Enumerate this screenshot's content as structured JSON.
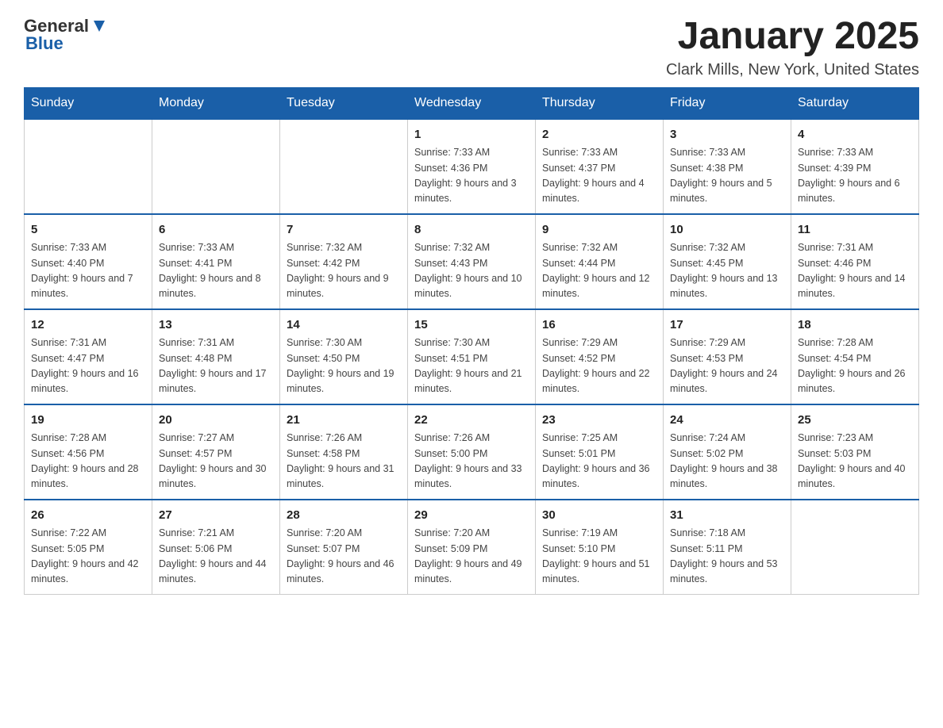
{
  "logo": {
    "general": "General",
    "blue": "Blue"
  },
  "title": "January 2025",
  "subtitle": "Clark Mills, New York, United States",
  "days_of_week": [
    "Sunday",
    "Monday",
    "Tuesday",
    "Wednesday",
    "Thursday",
    "Friday",
    "Saturday"
  ],
  "weeks": [
    [
      {
        "day": "",
        "info": ""
      },
      {
        "day": "",
        "info": ""
      },
      {
        "day": "",
        "info": ""
      },
      {
        "day": "1",
        "info": "Sunrise: 7:33 AM\nSunset: 4:36 PM\nDaylight: 9 hours and 3 minutes."
      },
      {
        "day": "2",
        "info": "Sunrise: 7:33 AM\nSunset: 4:37 PM\nDaylight: 9 hours and 4 minutes."
      },
      {
        "day": "3",
        "info": "Sunrise: 7:33 AM\nSunset: 4:38 PM\nDaylight: 9 hours and 5 minutes."
      },
      {
        "day": "4",
        "info": "Sunrise: 7:33 AM\nSunset: 4:39 PM\nDaylight: 9 hours and 6 minutes."
      }
    ],
    [
      {
        "day": "5",
        "info": "Sunrise: 7:33 AM\nSunset: 4:40 PM\nDaylight: 9 hours and 7 minutes."
      },
      {
        "day": "6",
        "info": "Sunrise: 7:33 AM\nSunset: 4:41 PM\nDaylight: 9 hours and 8 minutes."
      },
      {
        "day": "7",
        "info": "Sunrise: 7:32 AM\nSunset: 4:42 PM\nDaylight: 9 hours and 9 minutes."
      },
      {
        "day": "8",
        "info": "Sunrise: 7:32 AM\nSunset: 4:43 PM\nDaylight: 9 hours and 10 minutes."
      },
      {
        "day": "9",
        "info": "Sunrise: 7:32 AM\nSunset: 4:44 PM\nDaylight: 9 hours and 12 minutes."
      },
      {
        "day": "10",
        "info": "Sunrise: 7:32 AM\nSunset: 4:45 PM\nDaylight: 9 hours and 13 minutes."
      },
      {
        "day": "11",
        "info": "Sunrise: 7:31 AM\nSunset: 4:46 PM\nDaylight: 9 hours and 14 minutes."
      }
    ],
    [
      {
        "day": "12",
        "info": "Sunrise: 7:31 AM\nSunset: 4:47 PM\nDaylight: 9 hours and 16 minutes."
      },
      {
        "day": "13",
        "info": "Sunrise: 7:31 AM\nSunset: 4:48 PM\nDaylight: 9 hours and 17 minutes."
      },
      {
        "day": "14",
        "info": "Sunrise: 7:30 AM\nSunset: 4:50 PM\nDaylight: 9 hours and 19 minutes."
      },
      {
        "day": "15",
        "info": "Sunrise: 7:30 AM\nSunset: 4:51 PM\nDaylight: 9 hours and 21 minutes."
      },
      {
        "day": "16",
        "info": "Sunrise: 7:29 AM\nSunset: 4:52 PM\nDaylight: 9 hours and 22 minutes."
      },
      {
        "day": "17",
        "info": "Sunrise: 7:29 AM\nSunset: 4:53 PM\nDaylight: 9 hours and 24 minutes."
      },
      {
        "day": "18",
        "info": "Sunrise: 7:28 AM\nSunset: 4:54 PM\nDaylight: 9 hours and 26 minutes."
      }
    ],
    [
      {
        "day": "19",
        "info": "Sunrise: 7:28 AM\nSunset: 4:56 PM\nDaylight: 9 hours and 28 minutes."
      },
      {
        "day": "20",
        "info": "Sunrise: 7:27 AM\nSunset: 4:57 PM\nDaylight: 9 hours and 30 minutes."
      },
      {
        "day": "21",
        "info": "Sunrise: 7:26 AM\nSunset: 4:58 PM\nDaylight: 9 hours and 31 minutes."
      },
      {
        "day": "22",
        "info": "Sunrise: 7:26 AM\nSunset: 5:00 PM\nDaylight: 9 hours and 33 minutes."
      },
      {
        "day": "23",
        "info": "Sunrise: 7:25 AM\nSunset: 5:01 PM\nDaylight: 9 hours and 36 minutes."
      },
      {
        "day": "24",
        "info": "Sunrise: 7:24 AM\nSunset: 5:02 PM\nDaylight: 9 hours and 38 minutes."
      },
      {
        "day": "25",
        "info": "Sunrise: 7:23 AM\nSunset: 5:03 PM\nDaylight: 9 hours and 40 minutes."
      }
    ],
    [
      {
        "day": "26",
        "info": "Sunrise: 7:22 AM\nSunset: 5:05 PM\nDaylight: 9 hours and 42 minutes."
      },
      {
        "day": "27",
        "info": "Sunrise: 7:21 AM\nSunset: 5:06 PM\nDaylight: 9 hours and 44 minutes."
      },
      {
        "day": "28",
        "info": "Sunrise: 7:20 AM\nSunset: 5:07 PM\nDaylight: 9 hours and 46 minutes."
      },
      {
        "day": "29",
        "info": "Sunrise: 7:20 AM\nSunset: 5:09 PM\nDaylight: 9 hours and 49 minutes."
      },
      {
        "day": "30",
        "info": "Sunrise: 7:19 AM\nSunset: 5:10 PM\nDaylight: 9 hours and 51 minutes."
      },
      {
        "day": "31",
        "info": "Sunrise: 7:18 AM\nSunset: 5:11 PM\nDaylight: 9 hours and 53 minutes."
      },
      {
        "day": "",
        "info": ""
      }
    ]
  ]
}
